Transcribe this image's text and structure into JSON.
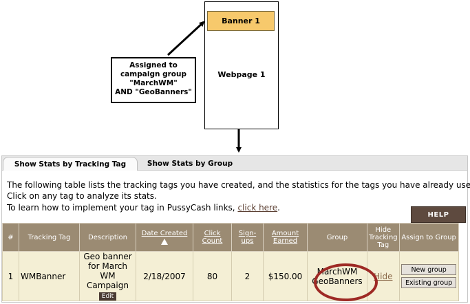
{
  "diagram": {
    "banner_label": "Banner 1",
    "webpage_label": "Webpage 1",
    "assigned_lines": [
      "Assigned to",
      "campaign group",
      "\"MarchWM\"",
      "AND \"GeoBanners\""
    ]
  },
  "tabs": [
    {
      "label": "Show Stats by Tracking Tag",
      "active": true
    },
    {
      "label": "Show Stats by Group",
      "active": false
    }
  ],
  "intro": {
    "line1": "The following table lists the tracking tags you have created, and the statistics for the tags you have already used.",
    "line2": "Click on any tag to analyze its stats.",
    "line3_prefix": "To learn how to implement your tag in PussyCash links,",
    "line3_link": "click here",
    "line3_suffix": "."
  },
  "help_label": "HELP",
  "table": {
    "headers": {
      "num": "#",
      "tracking_tag": "Tracking Tag",
      "description": "Description",
      "date_created": "Date Created",
      "click_count": "Click Count",
      "signups": "Sign-ups",
      "amount_earned": "Amount Earned",
      "group": "Group",
      "hide_tracking_tag": "Hide Tracking Tag",
      "assign_to_group": "Assign to Group"
    },
    "rows": [
      {
        "num": "1",
        "tracking_tag": "WMBanner",
        "description": "Geo banner for March WM Campaign",
        "edit_label": "Edit",
        "date_created": "2/18/2007",
        "click_count": "80",
        "signups": "2",
        "amount_earned": "$150.00",
        "group_lines": [
          "MarchWM",
          "GeoBanners"
        ],
        "hide_label": "Hide",
        "new_group_label": "New group",
        "existing_group_label": "Existing group"
      }
    ]
  },
  "colors": {
    "banner_fill": "#f7c96c",
    "header_bg": "#9b8b73",
    "row_bg": "#f4efd5",
    "help_bg": "#5e4a3f",
    "annotation_red": "#9e2a25"
  }
}
